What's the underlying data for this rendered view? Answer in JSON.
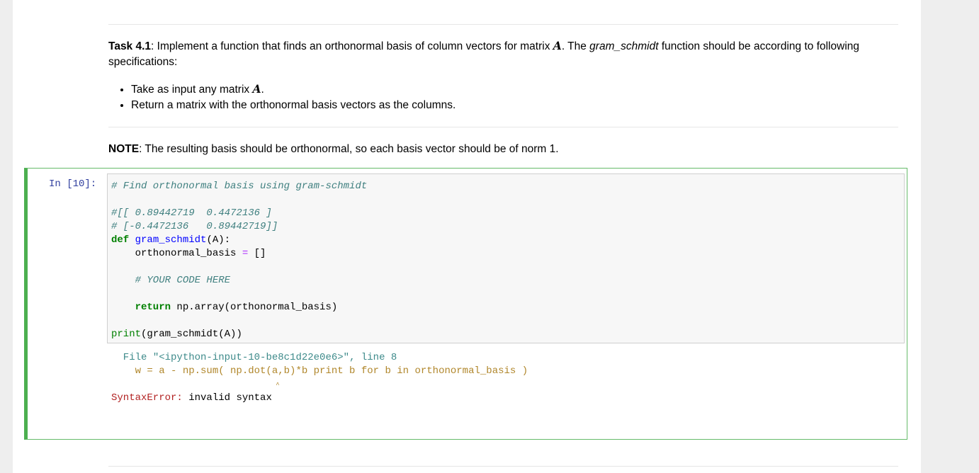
{
  "markdown": {
    "task_label": "Task 4.1",
    "task_text_1": ": Implement a function that finds an orthonormal basis of column vectors for matrix ",
    "matrix_symbol": "A",
    "task_text_2": ". The ",
    "function_name": "gram_schmidt",
    "task_text_3": " function should be according to following specifications:",
    "bullets": [
      {
        "text": "Take as input any matrix ",
        "math": "A",
        "tail": "."
      },
      {
        "text": "Return a matrix with the orthonormal basis vectors as the columns.",
        "math": "",
        "tail": ""
      }
    ],
    "note_label": "NOTE",
    "note_text": ": The resulting basis should be orthonormal, so each basis vector should be of norm 1."
  },
  "cell": {
    "prompt": "In  [10]:",
    "code": {
      "line1": "# Find orthonormal basis using gram-schmidt",
      "line2": "#[[ 0.89442719  0.4472136 ]",
      "line3": "# [-0.4472136   0.89442719]]",
      "def_kw": "def",
      "def_name": "gram_schmidt",
      "def_args": "(A):",
      "assign_var": "    orthonormal_basis ",
      "assign_op": "=",
      "assign_val": " []",
      "your_code": "    # YOUR CODE HERE",
      "return_kw": "    return",
      "return_expr": " np.array(orthonormal_basis)",
      "print_fn": "print",
      "print_args": "(gram_schmidt(A))"
    },
    "output": {
      "file_prefix": "  File ",
      "file_name": "\"<ipython-input-10-be8c1d22e0e6>\"",
      "line_info": ", line 8",
      "error_line": "    w = a - np.sum( np.dot(a,b)*b print b for b in orthonormal_basis )",
      "caret": "                                           ^",
      "error_type": "SyntaxError:",
      "error_msg": " invalid syntax"
    }
  }
}
